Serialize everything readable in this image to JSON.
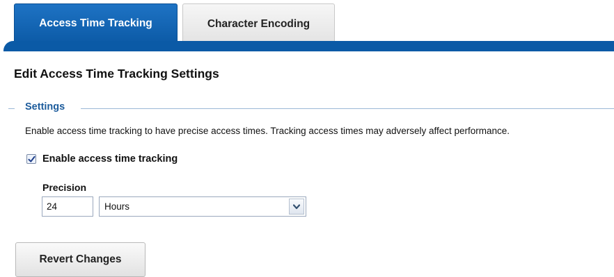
{
  "tabs": [
    {
      "label": "Access Time Tracking",
      "active": true
    },
    {
      "label": "Character Encoding",
      "active": false
    }
  ],
  "page_title": "Edit Access Time Tracking Settings",
  "settings": {
    "legend": "Settings",
    "description": "Enable access time tracking to have precise access times. Tracking access times may adversely affect performance.",
    "enable_checkbox": {
      "label": "Enable access time tracking",
      "checked": true
    },
    "precision": {
      "label": "Precision",
      "value": "24",
      "unit_selected": "Hours"
    }
  },
  "buttons": {
    "revert_label": "Revert Changes"
  },
  "icons": {
    "checkbox_check": "check-icon",
    "select_arrow": "chevron-down-icon"
  },
  "colors": {
    "accent": "#0b5aa6",
    "legend_text": "#1d5c9c",
    "legend_line": "#9bb8d6"
  }
}
